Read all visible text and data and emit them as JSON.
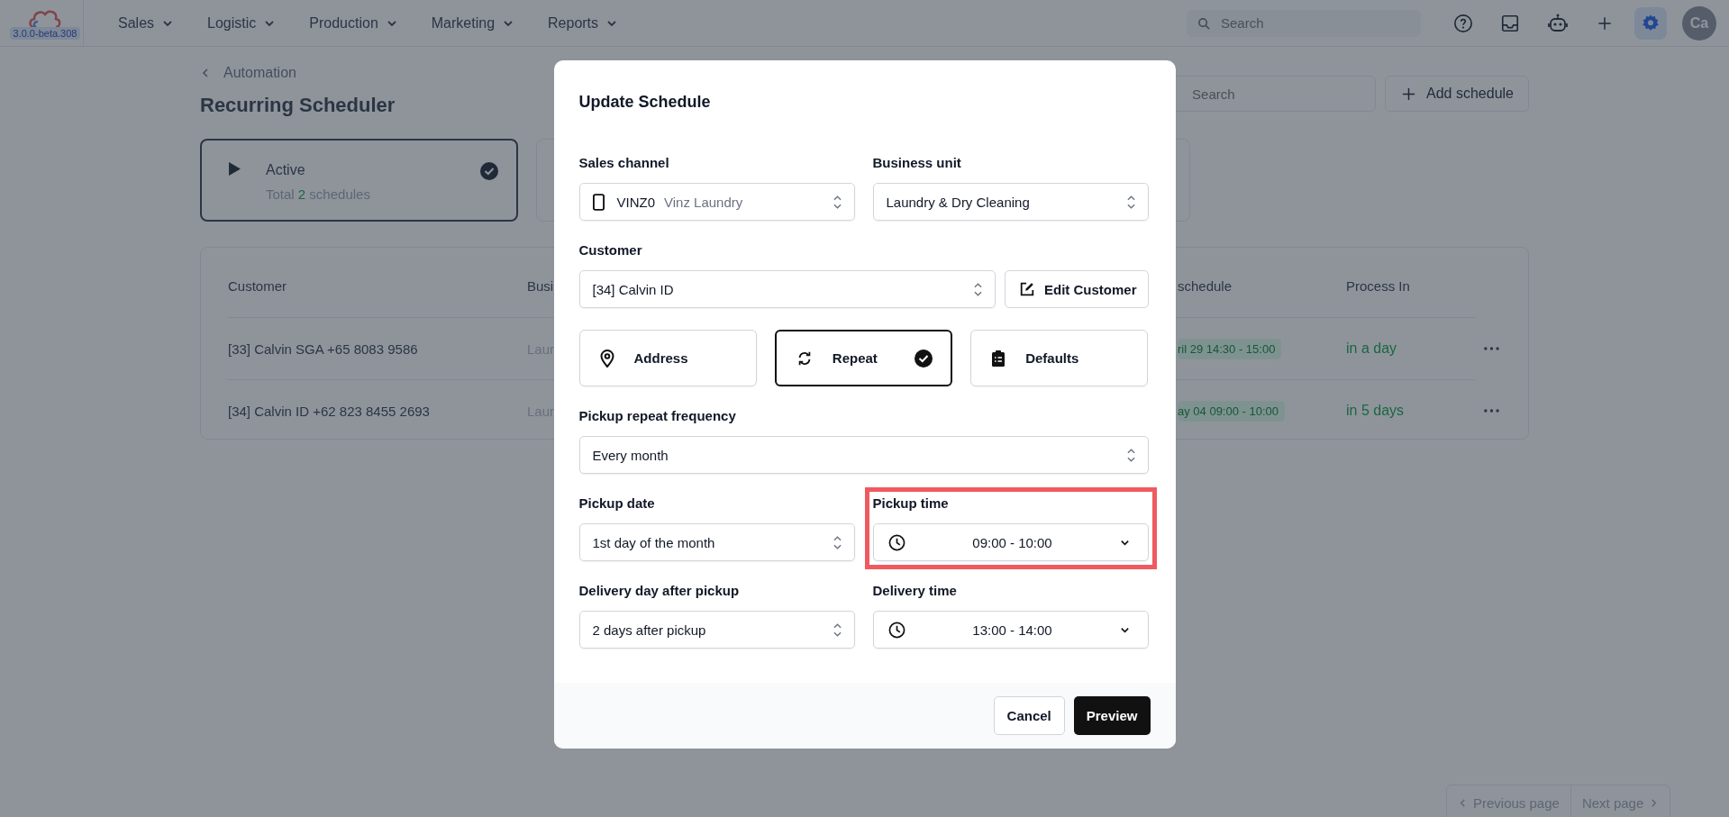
{
  "top_nav": {
    "version": "3.0.0-beta.308",
    "menus": [
      {
        "label": "Sales"
      },
      {
        "label": "Logistic"
      },
      {
        "label": "Production"
      },
      {
        "label": "Marketing"
      },
      {
        "label": "Reports"
      }
    ],
    "search": {
      "placeholder": "Search"
    },
    "avatar": "Ca"
  },
  "page": {
    "breadcrumb": "Automation",
    "title": "Recurring Scheduler",
    "search": {
      "placeholder": "Search"
    },
    "add_button": "Add schedule",
    "status_cards": [
      {
        "title": "Active",
        "summary_before": "Total",
        "count": "2",
        "summary_after": "schedules",
        "selected": true
      },
      {
        "selected": false
      }
    ],
    "table": {
      "columns": [
        "Customer",
        "Busi",
        "schedule",
        "Process In"
      ],
      "rows": [
        {
          "customer": "[33] Calvin SGA +65 8083 9586",
          "column_2": "Laur",
          "column_3": "ril 29 14:30 - 15:00",
          "process_in": "in a day"
        },
        {
          "customer": "[34] Calvin ID +62 823 8455 2693",
          "column_2": "Laur",
          "column_3": "ay 04 09:00 - 10:00",
          "process_in": "in 5 days"
        }
      ]
    },
    "pagination": [
      "Previous page",
      "Next page"
    ]
  },
  "modal": {
    "title": "Update Schedule",
    "sales_channel": {
      "label": "Sales channel",
      "code": "VINZ0",
      "name": "Vinz Laundry"
    },
    "business_unit": {
      "label": "Business unit",
      "value": "Laundry & Dry Cleaning"
    },
    "customer": {
      "label": "Customer",
      "value": "[34] Calvin ID",
      "edit_button": "Edit Customer"
    },
    "sections": [
      {
        "label": "Address",
        "kind": "pin",
        "selected": false
      },
      {
        "label": "Repeat",
        "kind": "repeat",
        "selected": true
      },
      {
        "label": "Defaults",
        "kind": "clipboard",
        "selected": false
      }
    ],
    "frequency": {
      "label": "Pickup repeat frequency",
      "value": "Every month"
    },
    "schedule_fields": [
      {
        "label": "Pickup date",
        "value": "1st day of the month",
        "kind": "select",
        "highlighted": false
      },
      {
        "label": "Pickup time",
        "value": "09:00 - 10:00",
        "kind": "time",
        "highlighted": true
      },
      {
        "label": "Delivery day after pickup",
        "value": "2 days after pickup",
        "kind": "select",
        "highlighted": false
      },
      {
        "label": "Delivery time",
        "value": "13:00 - 14:00",
        "kind": "time",
        "highlighted": false
      }
    ],
    "buttons": {
      "cancel": "Cancel",
      "preview": "Preview"
    }
  }
}
